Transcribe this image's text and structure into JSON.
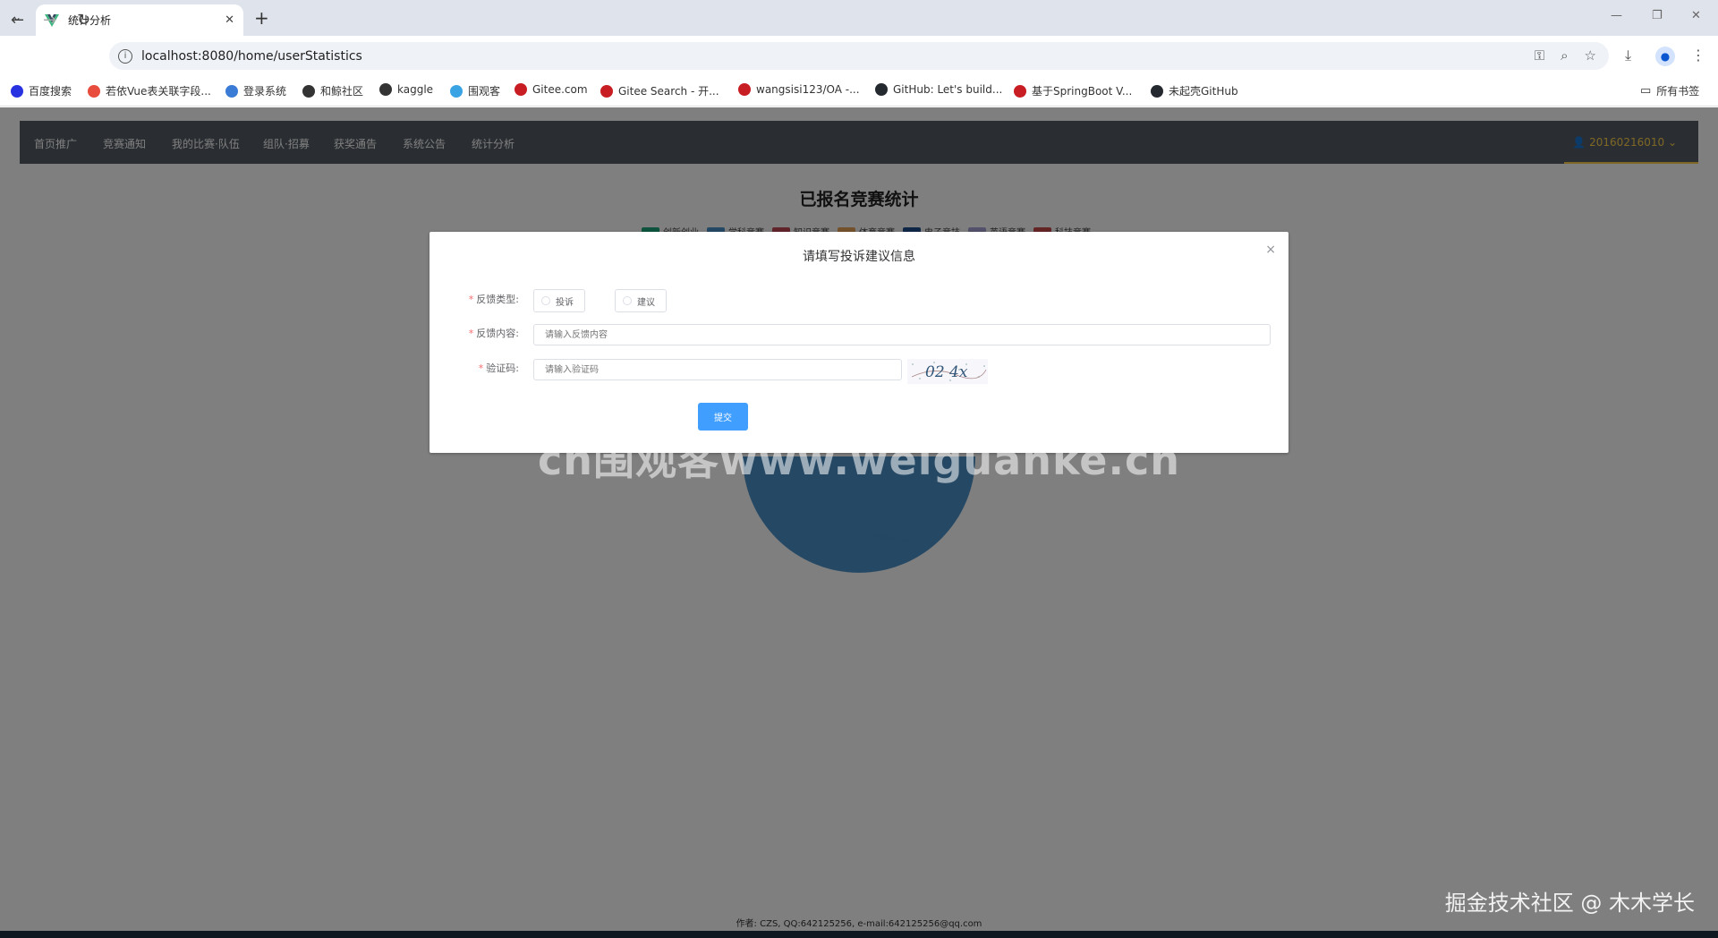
{
  "browser": {
    "tab_title": "统计分析",
    "tab_close": "✕",
    "new_tab": "+",
    "url": "localhost:8080/home/userStatistics",
    "bookmarks": [
      {
        "label": "百度搜索",
        "color": "#2932e1"
      },
      {
        "label": "若依Vue表关联字段...",
        "color": "#e74c3c"
      },
      {
        "label": "登录系统",
        "color": "#3a7bd5"
      },
      {
        "label": "和鲸社区",
        "color": "#333333"
      },
      {
        "label": "kaggle",
        "color": "#333333"
      },
      {
        "label": "围观客",
        "color": "#3aa3e3"
      },
      {
        "label": "Gitee.com",
        "color": "#c71d23"
      },
      {
        "label": "Gitee Search - 开...",
        "color": "#c71d23"
      },
      {
        "label": "wangsisi123/OA -...",
        "color": "#c71d23"
      },
      {
        "label": "GitHub: Let's build...",
        "color": "#24292f"
      },
      {
        "label": "基于SpringBoot V...",
        "color": "#c71d23"
      },
      {
        "label": "未起壳GitHub",
        "color": "#24292f"
      }
    ],
    "all_bookmarks": "所有书签"
  },
  "nav": {
    "items": [
      "首页推广",
      "竞赛通知",
      "我的比赛·队伍",
      "组队·招募",
      "获奖通告",
      "系统公告",
      "统计分析"
    ],
    "user": "20160216010"
  },
  "chart_data": {
    "type": "pie",
    "title": "已报名竞赛统计",
    "legend": [
      "创新创业",
      "学科竞赛",
      "知识竞赛",
      "体育竞赛",
      "电子竞技",
      "英语竞赛",
      "科技竞赛"
    ],
    "colors": [
      "#1aa77a",
      "#4a90c8",
      "#c04a55",
      "#e8a25a",
      "#1f4e8c",
      "#a6a3d6",
      "#c94a4a"
    ],
    "labels": [
      "学科竞赛"
    ]
  },
  "dialog": {
    "title": "请填写投诉建议信息",
    "close": "×",
    "type_label": "反馈类型:",
    "type_options": [
      "投诉",
      "建议"
    ],
    "content_label": "反馈内容:",
    "content_placeholder": "请输入反馈内容",
    "captcha_label": "验证码:",
    "captcha_placeholder": "请输入验证码",
    "captcha_text": "02 4x",
    "submit": "提交"
  },
  "footer": "作者: CZS, QQ:642125256, e-mail:642125256@qq.com",
  "watermarks": {
    "center": "cn围观客www.weiguanke.cn",
    "corner": "掘金技术社区 @ 木木学长"
  }
}
